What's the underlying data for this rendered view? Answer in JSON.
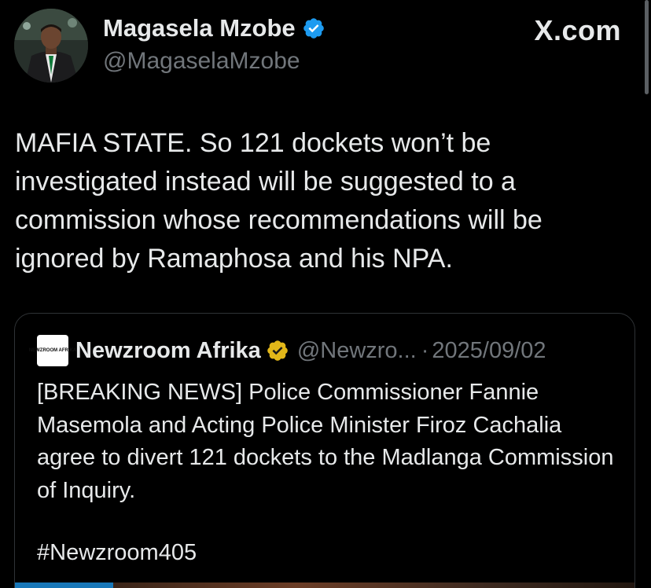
{
  "watermark": "X.com",
  "author": {
    "name": "Magasela Mzobe",
    "handle": "@MagaselaMzobe",
    "verified_badge_icon": "blue-verified-badge-icon",
    "avatar_icon": "profile-avatar"
  },
  "tweet": {
    "text": "MAFIA STATE. So 121 dockets won’t be investigated instead will be suggested to a commission whose recommendations will be ignored by Ramaphosa and his NPA."
  },
  "quote": {
    "name": "Newzroom Afrika",
    "logo_text": "NEWZROOM AFRIKA",
    "handle": "@Newzro...",
    "separator": "·",
    "date": "2025/09/02",
    "badge_icon": "gold-verified-badge-icon",
    "text": "[BREAKING NEWS] Police Commissioner Fannie Masemola and Acting Police Minister Firoz Cachalia agree to divert 121 dockets to the Madlanga Commission of Inquiry.",
    "hashtag": "#Newzroom405"
  },
  "colors": {
    "background": "#000000",
    "text": "#e7e9ea",
    "muted": "#71767b",
    "verified_blue": "#1d9bf0",
    "verified_gold": "#e2b719",
    "border": "#2f3336"
  }
}
